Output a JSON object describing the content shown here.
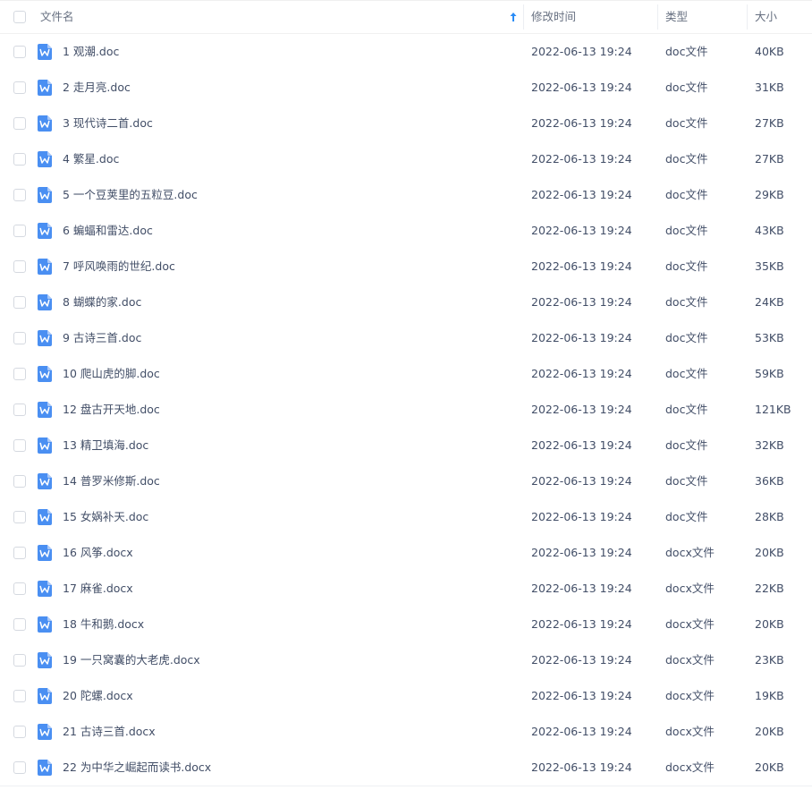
{
  "header": {
    "name": "文件名",
    "mtime": "修改时间",
    "type": "类型",
    "size": "大小"
  },
  "sort": {
    "column": "name",
    "direction": "ascending",
    "icon": "arrow-up-icon"
  },
  "colors": {
    "icon_blue": "#4a8ff2",
    "text": "#424e67",
    "header_text": "#666f80",
    "sort_arrow": "#2a8cf6"
  },
  "files": [
    {
      "name": "1 观潮.doc",
      "mtime": "2022-06-13 19:24",
      "type": "doc文件",
      "size": "40KB"
    },
    {
      "name": "2 走月亮.doc",
      "mtime": "2022-06-13 19:24",
      "type": "doc文件",
      "size": "31KB"
    },
    {
      "name": "3 现代诗二首.doc",
      "mtime": "2022-06-13 19:24",
      "type": "doc文件",
      "size": "27KB"
    },
    {
      "name": "4 繁星.doc",
      "mtime": "2022-06-13 19:24",
      "type": "doc文件",
      "size": "27KB"
    },
    {
      "name": "5 一个豆荚里的五粒豆.doc",
      "mtime": "2022-06-13 19:24",
      "type": "doc文件",
      "size": "29KB"
    },
    {
      "name": "6 蝙蝠和雷达.doc",
      "mtime": "2022-06-13 19:24",
      "type": "doc文件",
      "size": "43KB"
    },
    {
      "name": "7 呼风唤雨的世纪.doc",
      "mtime": "2022-06-13 19:24",
      "type": "doc文件",
      "size": "35KB"
    },
    {
      "name": "8 蝴蝶的家.doc",
      "mtime": "2022-06-13 19:24",
      "type": "doc文件",
      "size": "24KB"
    },
    {
      "name": "9 古诗三首.doc",
      "mtime": "2022-06-13 19:24",
      "type": "doc文件",
      "size": "53KB"
    },
    {
      "name": "10 爬山虎的脚.doc",
      "mtime": "2022-06-13 19:24",
      "type": "doc文件",
      "size": "59KB"
    },
    {
      "name": "12 盘古开天地.doc",
      "mtime": "2022-06-13 19:24",
      "type": "doc文件",
      "size": "121KB"
    },
    {
      "name": "13 精卫填海.doc",
      "mtime": "2022-06-13 19:24",
      "type": "doc文件",
      "size": "32KB"
    },
    {
      "name": "14 普罗米修斯.doc",
      "mtime": "2022-06-13 19:24",
      "type": "doc文件",
      "size": "36KB"
    },
    {
      "name": "15 女娲补天.doc",
      "mtime": "2022-06-13 19:24",
      "type": "doc文件",
      "size": "28KB"
    },
    {
      "name": "16 风筝.docx",
      "mtime": "2022-06-13 19:24",
      "type": "docx文件",
      "size": "20KB"
    },
    {
      "name": "17 麻雀.docx",
      "mtime": "2022-06-13 19:24",
      "type": "docx文件",
      "size": "22KB"
    },
    {
      "name": "18 牛和鹅.docx",
      "mtime": "2022-06-13 19:24",
      "type": "docx文件",
      "size": "20KB"
    },
    {
      "name": "19 一只窝囊的大老虎.docx",
      "mtime": "2022-06-13 19:24",
      "type": "docx文件",
      "size": "23KB"
    },
    {
      "name": "20 陀螺.docx",
      "mtime": "2022-06-13 19:24",
      "type": "docx文件",
      "size": "19KB"
    },
    {
      "name": "21 古诗三首.docx",
      "mtime": "2022-06-13 19:24",
      "type": "docx文件",
      "size": "20KB"
    },
    {
      "name": "22 为中华之崛起而读书.docx",
      "mtime": "2022-06-13 19:24",
      "type": "docx文件",
      "size": "20KB"
    }
  ]
}
